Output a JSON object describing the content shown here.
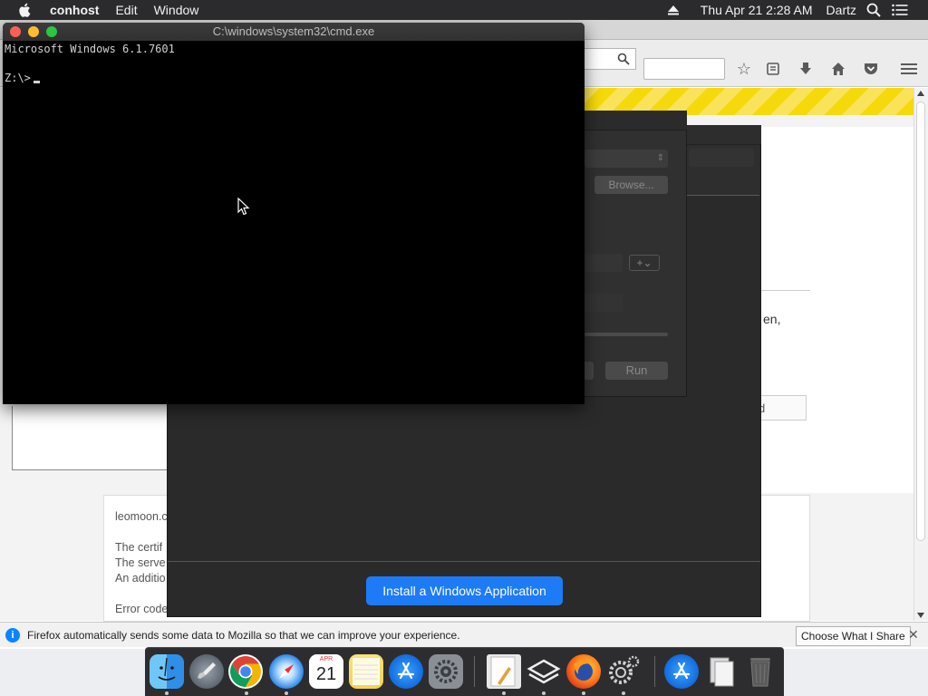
{
  "menubar": {
    "app_name": "conhost",
    "items": [
      "Edit",
      "Window"
    ],
    "clock": "Thu Apr 21  2:28 AM",
    "user": "Dartz"
  },
  "terminal": {
    "title": "C:\\windows\\system32\\cmd.exe",
    "line1": "Microsoft Windows 6.1.7601",
    "prompt": "Z:\\>"
  },
  "run_dialog": {
    "browse_label": "Browse...",
    "run_label": "Run"
  },
  "wineskin": {
    "install_button": "Install a Windows Application"
  },
  "firefox": {
    "fragment_right": "en,",
    "fragment_button": "d",
    "page_lines": [
      "leomoon.c",
      "The certif",
      "The serve",
      "An additio",
      "Error code"
    ],
    "notification": "Firefox automatically sends some data to Mozilla so that we can improve your experience.",
    "notification_button": "Choose What I Share"
  },
  "dock": {
    "calendar_month": "APR",
    "calendar_day": "21"
  }
}
